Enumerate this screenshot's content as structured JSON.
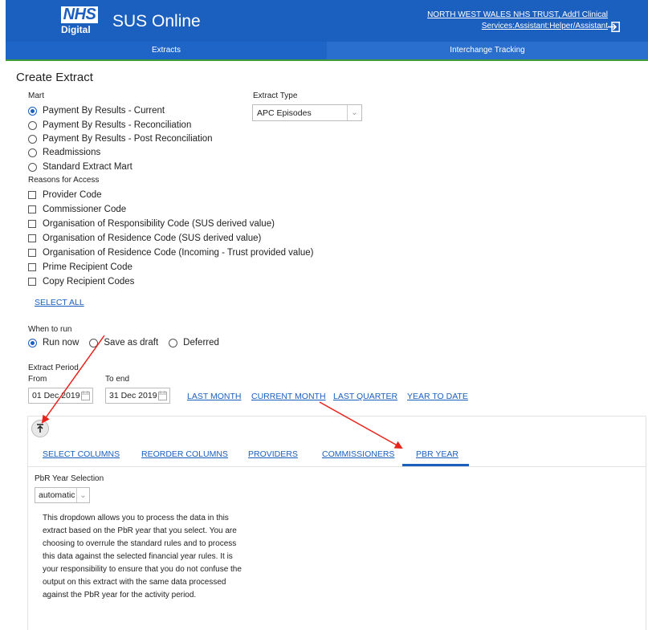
{
  "header": {
    "logo_text": "NHS",
    "logo_sub": "Digital",
    "app_title": "SUS Online",
    "user_line1": "NORTH WEST WALES NHS TRUST, Add'l Clinical",
    "user_line2": "Services:Assistant:Helper/Assistant"
  },
  "nav": {
    "tabs": [
      {
        "label": "Extracts",
        "active": true
      },
      {
        "label": "Interchange Tracking",
        "active": false
      }
    ]
  },
  "page_title": "Create Extract",
  "mart": {
    "label": "Mart",
    "options": [
      {
        "label": "Payment By Results - Current",
        "selected": true
      },
      {
        "label": "Payment By Results - Reconciliation",
        "selected": false
      },
      {
        "label": "Payment By Results - Post Reconciliation",
        "selected": false
      },
      {
        "label": "Readmissions",
        "selected": false
      },
      {
        "label": "Standard Extract Mart",
        "selected": false
      }
    ]
  },
  "extract_type": {
    "label": "Extract Type",
    "value": "APC Episodes"
  },
  "reasons": {
    "label": "Reasons for Access",
    "items": [
      "Provider Code",
      "Commissioner Code",
      "Organisation of Responsibility Code (SUS derived value)",
      "Organisation of Residence Code (SUS derived value)",
      "Organisation of Residence Code (Incoming - Trust provided value)",
      "Prime Recipient Code",
      "Copy Recipient Codes"
    ],
    "select_all": "SELECT ALL"
  },
  "when_to_run": {
    "label": "When to run",
    "options": [
      {
        "label": "Run now",
        "selected": true
      },
      {
        "label": "Save as draft",
        "selected": false
      },
      {
        "label": "Deferred",
        "selected": false
      }
    ]
  },
  "period": {
    "label": "Extract Period",
    "from_label": "From",
    "to_label": "To end",
    "from_value": "01 Dec 2019",
    "to_value": "31 Dec 2019",
    "shortcuts": [
      "LAST MONTH",
      "CURRENT MONTH",
      "LAST QUARTER",
      "YEAR TO DATE"
    ]
  },
  "tabs": {
    "items": [
      "SELECT COLUMNS",
      "REORDER COLUMNS",
      "PROVIDERS",
      "COMMISSIONERS",
      "PBR YEAR"
    ],
    "active": "PBR YEAR"
  },
  "pbr": {
    "label": "PbR Year Selection",
    "value": "automatic",
    "description": "This dropdown allows you to process the data in this extract based on the PbR year that you select. You are choosing to overrule the standard rules and to process this data against the selected financial year rules. It is your responsibility to ensure that you do not confuse the output on this extract with the same data processed against the PbR year for the activity period."
  },
  "colors": {
    "brand": "#1b5fbf",
    "nav_underline": "#3f9c35",
    "annotation": "#e8231c"
  }
}
